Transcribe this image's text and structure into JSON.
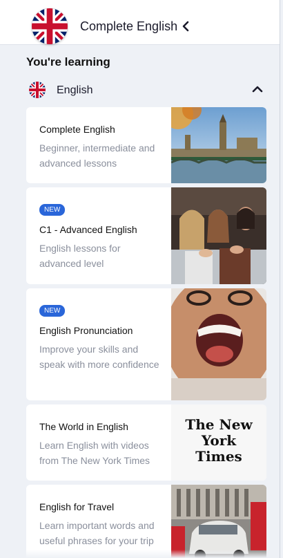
{
  "header": {
    "title": "Complete English",
    "flag_icon": "uk-flag-icon",
    "back_icon": "chevron-left-icon"
  },
  "section": {
    "title": "You're learning"
  },
  "language": {
    "name": "English",
    "collapse_icon": "chevron-up-icon"
  },
  "courses": [
    {
      "title": "Complete English",
      "description": "Beginner, intermediate and advanced lessons",
      "badge": "",
      "image": "london-bridge-photo"
    },
    {
      "title": "C1 - Advanced English",
      "description": "English lessons for advanced level",
      "badge": "NEW",
      "image": "applauding-audience-photo"
    },
    {
      "title": "English Pronunciation",
      "description": "Improve your skills and speak with more confidence",
      "badge": "NEW",
      "image": "shouting-woman-photo"
    },
    {
      "title": "The World in English",
      "description": "Learn English with videos from The New York Times",
      "badge": "",
      "image": "new-york-times-logo"
    },
    {
      "title": "English for Travel",
      "description": "Learn important words and useful phrases for your trip",
      "badge": "",
      "image": "london-taxi-photo"
    }
  ],
  "nyt_logo_text": "The New York Times",
  "colors": {
    "accent_badge": "#2a66d9",
    "background": "#eef1f6",
    "card": "#ffffff"
  }
}
